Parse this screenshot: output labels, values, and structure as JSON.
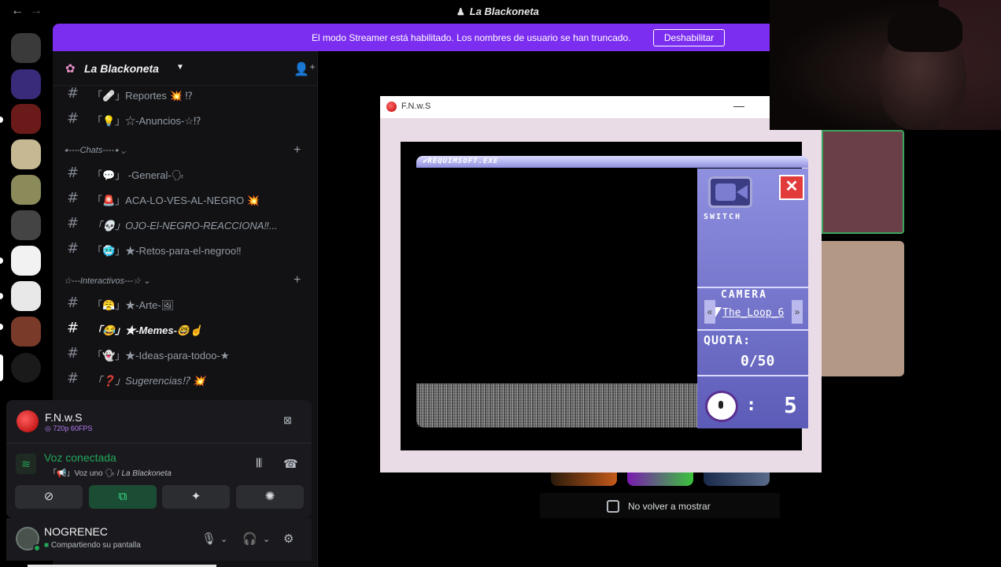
{
  "window": {
    "title": "La Blackoneta",
    "back": "←",
    "forward": "→"
  },
  "banner": {
    "text": "El modo Streamer está habilitado. Los nombres de usuario se han truncado.",
    "button": "Deshabilitar"
  },
  "server": {
    "name": "La Blackoneta",
    "chevron": "⌄"
  },
  "channels_top": [
    {
      "label": "「🩹」Reportes 💥 ⁉"
    },
    {
      "label": "「💡」☆-Anuncios-☆⁉"
    }
  ],
  "categories": {
    "chats": "⭑----Chats----⭑",
    "interactivos": "☆---Interactivos---☆"
  },
  "channels_chats": [
    {
      "label": "「💬」 -General-🗣"
    },
    {
      "label": "「🚨」ACA-LO-VES-AL-NEGRO 💥"
    },
    {
      "label": "「💀」OJO-El-NEGRO-REACCIONA‼..."
    },
    {
      "label": "「🥶」★-Retos-para-el-negroo‼"
    }
  ],
  "channels_interactivos": [
    {
      "label": "「😤」★-Arte-🖼"
    },
    {
      "label": "「😂」★-Memes-🤓☝"
    },
    {
      "label": "「👻」★-Ideas-para-todoo-★"
    },
    {
      "label": "「❓」Sugerencias⁉ 💥"
    }
  ],
  "stream": {
    "app_name": "F.N.w.S",
    "quality": "◎ 720p 60FPS"
  },
  "voice": {
    "status": "Voz conectada",
    "channel": "「📢」Voz uno 🗣 / ",
    "server": "La Blackoneta"
  },
  "user": {
    "name": "NOGRENEC",
    "status": "Compartiendo su pantalla"
  },
  "game": {
    "window_title": "F.N.w.S",
    "exe_title": "✔REQUIMSOFT.EXE",
    "switch_label": "SWITCH",
    "camera_label": "CAMERA",
    "camera_name": "The_Loop_6",
    "quota_label": "QUOTA:",
    "quota_value": "0/50",
    "timer_value": "5",
    "timer_colon": ":",
    "close": "✕"
  },
  "popup": {
    "no_show_label": "No volver a mostrar"
  },
  "colors": {
    "accent": "#7c2ef0",
    "online": "#23a55a"
  }
}
